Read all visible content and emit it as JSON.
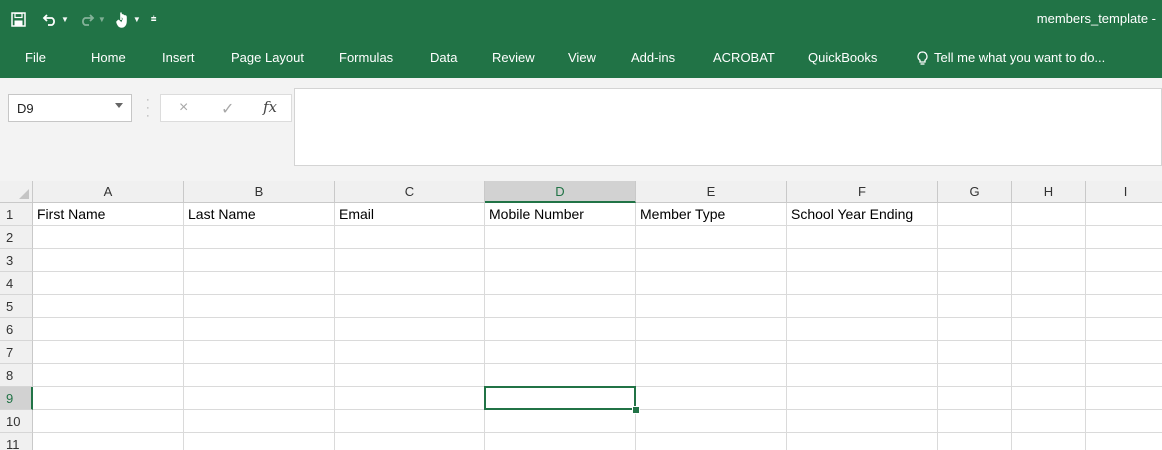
{
  "window": {
    "title": "members_template -"
  },
  "ribbon": {
    "tabs": [
      "File",
      "Home",
      "Insert",
      "Page Layout",
      "Formulas",
      "Data",
      "Review",
      "View",
      "Add-ins",
      "ACROBAT",
      "QuickBooks"
    ],
    "tell_me": "Tell me what you want to do..."
  },
  "formula_bar": {
    "name_box": "D9",
    "fx_label": "fx",
    "cancel_icon": "×",
    "enter_icon": "✓",
    "content": ""
  },
  "sheet": {
    "columns": [
      "A",
      "B",
      "C",
      "D",
      "E",
      "F",
      "G",
      "H",
      "I"
    ],
    "selected_column": "D",
    "rows": [
      "1",
      "2",
      "3",
      "4",
      "5",
      "6",
      "7",
      "8",
      "9",
      "10",
      "11"
    ],
    "selected_row": "9",
    "active_cell": "D9",
    "header_row": [
      "First Name",
      "Last Name",
      "Email",
      "Mobile Number",
      "Member Type",
      "School Year Ending",
      "",
      "",
      ""
    ]
  },
  "colors": {
    "accent": "#217346",
    "header_bg": "#f0f0f0",
    "gridline": "#dadada"
  }
}
